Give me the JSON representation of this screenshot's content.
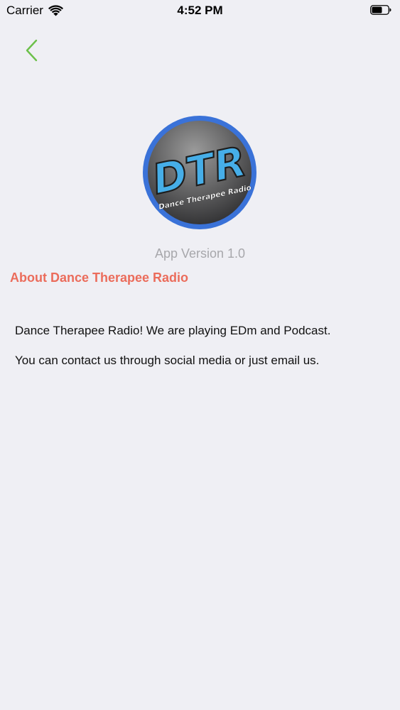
{
  "status_bar": {
    "carrier": "Carrier",
    "time": "4:52 PM",
    "wifi_icon": "wifi-icon",
    "battery_icon": "battery-icon"
  },
  "nav": {
    "back_icon": "chevron-left-icon",
    "accent_color": "#6cc04a"
  },
  "logo": {
    "initials": "DTR",
    "name": "Dance Therapee Radio"
  },
  "app_version": "App Version 1.0",
  "about": {
    "title": "About Dance Therapee Radio",
    "title_color": "#eb6c5b",
    "paragraphs": [
      "Dance Therapee Radio! We are playing EDm and Podcast.",
      "You can contact us through social media or just email us."
    ]
  }
}
